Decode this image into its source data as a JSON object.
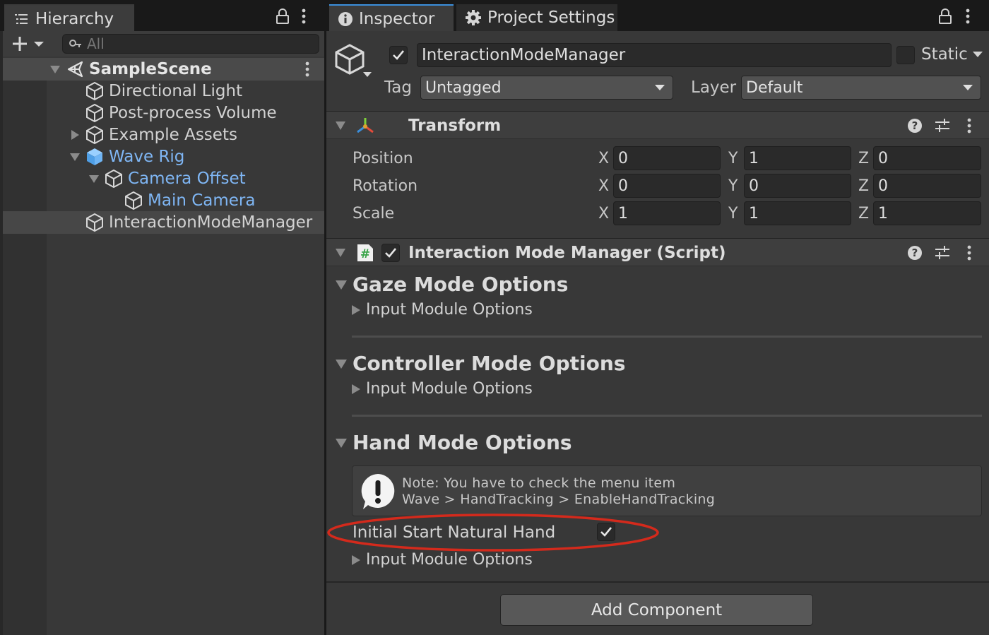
{
  "hierarchy": {
    "tab_label": "Hierarchy",
    "search_placeholder": "All",
    "scene": "SampleScene",
    "items": [
      {
        "label": "Directional Light"
      },
      {
        "label": "Post-process Volume"
      },
      {
        "label": "Example Assets"
      },
      {
        "label": "Wave Rig"
      },
      {
        "label": "Camera Offset"
      },
      {
        "label": "Main Camera"
      },
      {
        "label": "InteractionModeManager"
      }
    ]
  },
  "inspector": {
    "tabs": [
      {
        "label": "Inspector"
      },
      {
        "label": "Project Settings"
      }
    ],
    "object_name": "InteractionModeManager",
    "static_label": "Static",
    "tag_label": "Tag",
    "tag_value": "Untagged",
    "layer_label": "Layer",
    "layer_value": "Default",
    "transform": {
      "title": "Transform",
      "rows": [
        {
          "label": "Position",
          "x": "0",
          "y": "1",
          "z": "0"
        },
        {
          "label": "Rotation",
          "x": "0",
          "y": "0",
          "z": "0"
        },
        {
          "label": "Scale",
          "x": "1",
          "y": "1",
          "z": "1"
        }
      ],
      "axis_x": "X",
      "axis_y": "Y",
      "axis_z": "Z"
    },
    "script": {
      "title": "Interaction Mode Manager (Script)",
      "gaze": {
        "title": "Gaze Mode Options",
        "sub": "Input Module Options"
      },
      "controller": {
        "title": "Controller Mode Options",
        "sub": "Input Module Options"
      },
      "hand": {
        "title": "Hand Mode Options",
        "note_line1": "Note: You have to check the menu item",
        "note_line2": "Wave > HandTracking > EnableHandTracking",
        "natural_hand_label": "Initial Start Natural Hand",
        "sub": "Input Module Options"
      }
    },
    "add_component": "Add Component"
  },
  "colors": {
    "accent_tab": "#3b8fdc",
    "prefab_blue": "#7fb6f4",
    "highlight_ellipse": "#d42a1c"
  }
}
